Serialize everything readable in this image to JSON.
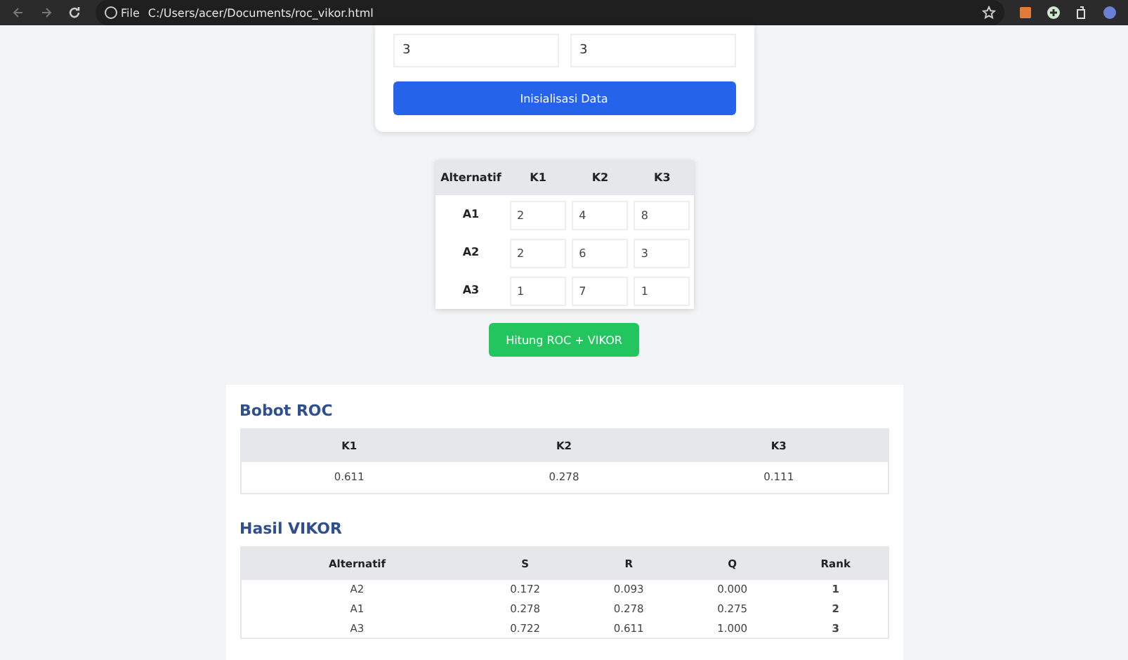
{
  "browser": {
    "chip": "File",
    "url": "C:/Users/acer/Documents/roc_vikor.html"
  },
  "setup": {
    "fields": [
      {
        "value": "3"
      },
      {
        "value": "3"
      }
    ],
    "button": "Inisialisasi Data"
  },
  "matrix": {
    "columns": [
      "Alternatif",
      "K1",
      "K2",
      "K3"
    ],
    "rows": [
      {
        "name": "A1",
        "values": [
          "2",
          "4",
          "8"
        ]
      },
      {
        "name": "A2",
        "values": [
          "2",
          "6",
          "3"
        ]
      },
      {
        "name": "A3",
        "values": [
          "1",
          "7",
          "1"
        ]
      }
    ],
    "button": "Hitung ROC + VIKOR"
  },
  "roc": {
    "title": "Bobot ROC",
    "columns": [
      "K1",
      "K2",
      "K3"
    ],
    "values": [
      "0.611",
      "0.278",
      "0.111"
    ]
  },
  "vikor": {
    "title": "Hasil VIKOR",
    "columns": [
      "Alternatif",
      "S",
      "R",
      "Q",
      "Rank"
    ],
    "rows": [
      [
        "A2",
        "0.172",
        "0.093",
        "0.000",
        "1"
      ],
      [
        "A1",
        "0.278",
        "0.278",
        "0.275",
        "2"
      ],
      [
        "A3",
        "0.722",
        "0.611",
        "1.000",
        "3"
      ]
    ]
  }
}
